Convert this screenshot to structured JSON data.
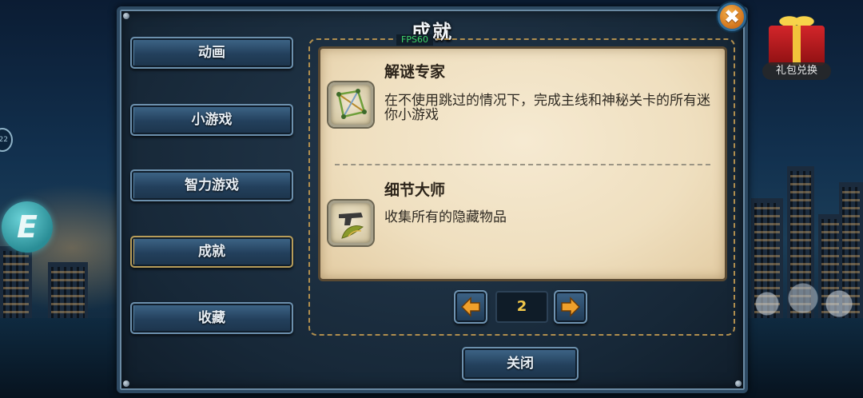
{
  "dialog": {
    "title": "成就"
  },
  "menu": {
    "items": [
      {
        "label": "动画",
        "active": false
      },
      {
        "label": "小游戏",
        "active": false
      },
      {
        "label": "智力游戏",
        "active": false
      },
      {
        "label": "成就",
        "active": true
      },
      {
        "label": "收藏",
        "active": false
      }
    ]
  },
  "hud": {
    "fps": "FPS60",
    "gift_label": "礼包兑换",
    "left_badge": "22",
    "left_icon_letter": "E"
  },
  "achievements": [
    {
      "title": "解谜专家",
      "description": "在不使用跳过的情况下，完成主线和神秘关卡的所有迷你小游戏",
      "icon": "puzzle-diagram-icon"
    },
    {
      "title": "细节大师",
      "description": "收集所有的隐藏物品",
      "icon": "pistol-and-leaf-icon"
    }
  ],
  "pager": {
    "current_page": "2",
    "prev_icon": "arrow-left-icon",
    "next_icon": "arrow-right-icon"
  },
  "buttons": {
    "close_label": "关闭",
    "close_icon": "close-x-icon"
  },
  "colors": {
    "accent_orange": "#e8891f",
    "parchment": "#f2e4c6",
    "fps_green": "#3fd46a",
    "page_number": "#f2c84a"
  }
}
